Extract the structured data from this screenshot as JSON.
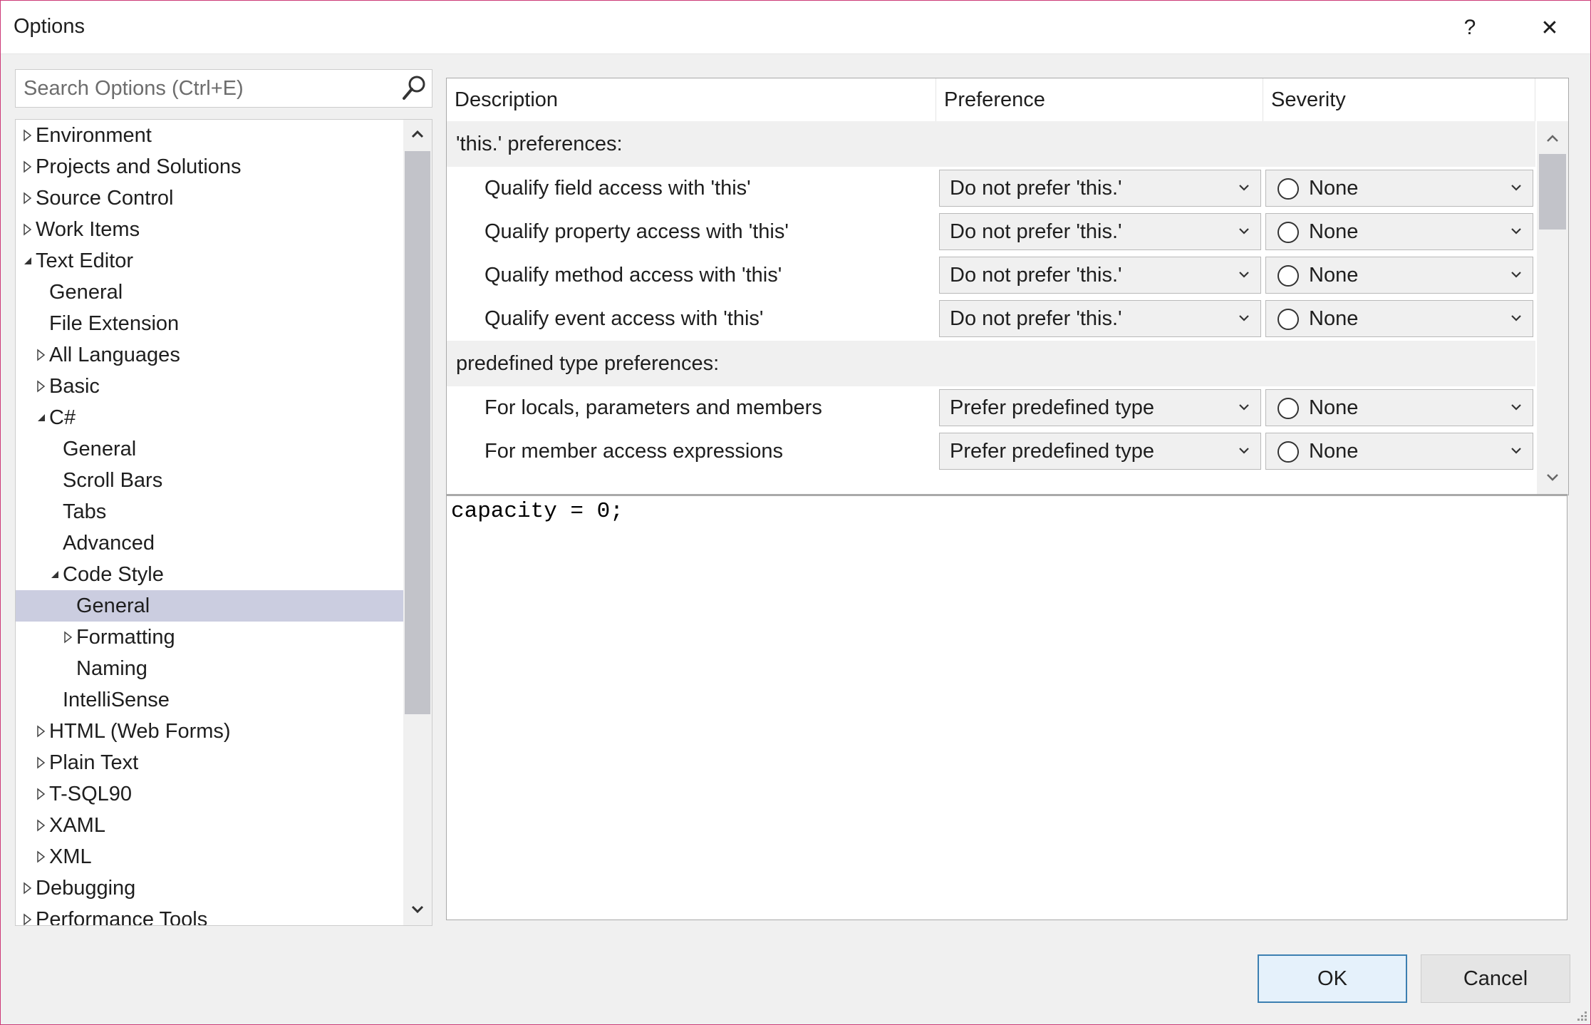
{
  "window": {
    "title": "Options",
    "help_label": "?",
    "close_label": "✕"
  },
  "search": {
    "placeholder": "Search Options (Ctrl+E)"
  },
  "tree": {
    "items": [
      {
        "label": "Environment",
        "level": 0,
        "expander": "collapsed"
      },
      {
        "label": "Projects and Solutions",
        "level": 0,
        "expander": "collapsed"
      },
      {
        "label": "Source Control",
        "level": 0,
        "expander": "collapsed"
      },
      {
        "label": "Work Items",
        "level": 0,
        "expander": "collapsed"
      },
      {
        "label": "Text Editor",
        "level": 0,
        "expander": "expanded"
      },
      {
        "label": "General",
        "level": 1,
        "expander": "none"
      },
      {
        "label": "File Extension",
        "level": 1,
        "expander": "none"
      },
      {
        "label": "All Languages",
        "level": 1,
        "expander": "collapsed"
      },
      {
        "label": "Basic",
        "level": 1,
        "expander": "collapsed"
      },
      {
        "label": "C#",
        "level": 1,
        "expander": "expanded"
      },
      {
        "label": "General",
        "level": 2,
        "expander": "none"
      },
      {
        "label": "Scroll Bars",
        "level": 2,
        "expander": "none"
      },
      {
        "label": "Tabs",
        "level": 2,
        "expander": "none"
      },
      {
        "label": "Advanced",
        "level": 2,
        "expander": "none"
      },
      {
        "label": "Code Style",
        "level": 2,
        "expander": "expanded"
      },
      {
        "label": "General",
        "level": 3,
        "expander": "none",
        "selected": true
      },
      {
        "label": "Formatting",
        "level": 3,
        "expander": "collapsed"
      },
      {
        "label": "Naming",
        "level": 3,
        "expander": "none"
      },
      {
        "label": "IntelliSense",
        "level": 2,
        "expander": "none"
      },
      {
        "label": "HTML (Web Forms)",
        "level": 1,
        "expander": "collapsed"
      },
      {
        "label": "Plain Text",
        "level": 1,
        "expander": "collapsed"
      },
      {
        "label": "T-SQL90",
        "level": 1,
        "expander": "collapsed"
      },
      {
        "label": "XAML",
        "level": 1,
        "expander": "collapsed"
      },
      {
        "label": "XML",
        "level": 1,
        "expander": "collapsed"
      },
      {
        "label": "Debugging",
        "level": 0,
        "expander": "collapsed"
      },
      {
        "label": "Performance Tools",
        "level": 0,
        "expander": "collapsed"
      }
    ]
  },
  "grid": {
    "columns": [
      "Description",
      "Preference",
      "Severity"
    ],
    "groups": [
      {
        "label": "'this.' preferences:",
        "rows": [
          {
            "description": "Qualify field access with 'this'",
            "preference": "Do not prefer 'this.'",
            "severity": "None"
          },
          {
            "description": "Qualify property access with 'this'",
            "preference": "Do not prefer 'this.'",
            "severity": "None"
          },
          {
            "description": "Qualify method access with 'this'",
            "preference": "Do not prefer 'this.'",
            "severity": "None"
          },
          {
            "description": "Qualify event access with 'this'",
            "preference": "Do not prefer 'this.'",
            "severity": "None"
          }
        ]
      },
      {
        "label": "predefined type preferences:",
        "rows": [
          {
            "description": "For locals, parameters and members",
            "preference": "Prefer predefined type",
            "severity": "None"
          },
          {
            "description": "For member access expressions",
            "preference": "Prefer predefined type",
            "severity": "None"
          }
        ]
      }
    ]
  },
  "preview": {
    "code": "capacity = 0;"
  },
  "buttons": {
    "ok": "OK",
    "cancel": "Cancel"
  },
  "colors": {
    "accent_border": "#cc3a78",
    "selection": "#cbcde0",
    "primary_button_border": "#3c7fb1"
  }
}
